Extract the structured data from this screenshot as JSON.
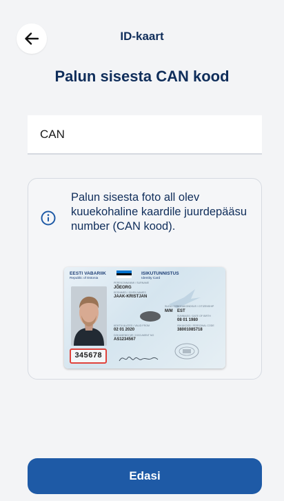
{
  "header": {
    "title": "ID-kaart",
    "back_icon": "arrow-left-icon"
  },
  "page": {
    "title": "Palun sisesta CAN kood"
  },
  "can_input": {
    "placeholder": "CAN",
    "value": ""
  },
  "info": {
    "icon": "info-icon",
    "text": "Palun sisesta foto all olev kuuekohaline kaardile juurdepääsu number (CAN kood)."
  },
  "id_card": {
    "country": "EESTI VABARIIK",
    "country_en": "Republic of Estonia",
    "doc_type": "ISIKUTUNNISTUS",
    "doc_type_en": "Identity Card",
    "surname": "JÕEORG",
    "given_names": "JAAK-KRISTJAN",
    "sex": "M/M",
    "citizenship": "EST",
    "birth_date": "08 01 1980",
    "issue_date": "02 01 2020",
    "personal_code": "38001085718",
    "doc_number": "AS1234567",
    "can": "345678"
  },
  "footer": {
    "next_label": "Edasi"
  },
  "colors": {
    "background": "#f3f4f6",
    "primary": "#1e5aa6",
    "title_text": "#0f2d5a",
    "can_highlight": "#e0413a"
  }
}
